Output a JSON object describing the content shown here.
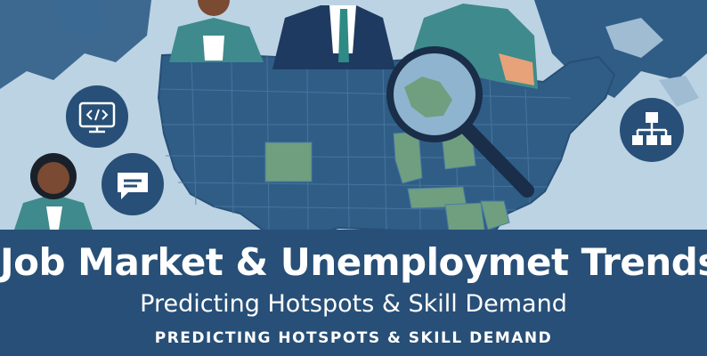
{
  "banner": {
    "title": "Job Market & Unemploymet Trends",
    "subtitle": "Predicting Hotspots & Skill Demand",
    "tagline": "PREDICTING HOTSPOTS & SKILL DEMAND"
  },
  "icons": [
    "code-monitor-icon",
    "chat-bubble-icon",
    "org-chart-icon",
    "magnifying-glass-icon"
  ],
  "colors": {
    "background": "#bcd3e3",
    "map": "#2f5d86",
    "map_highlight": "#6f9f7f",
    "banner": "#274f77",
    "text": "#ffffff"
  }
}
